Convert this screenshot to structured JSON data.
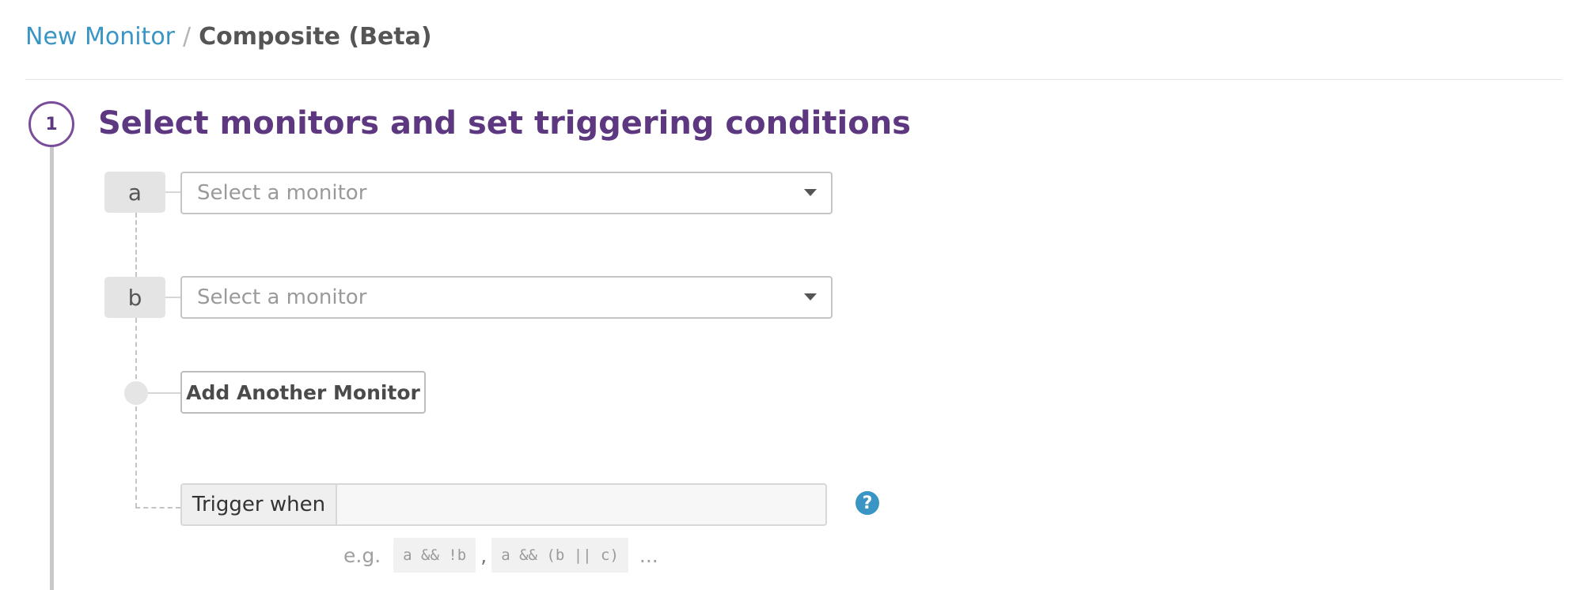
{
  "breadcrumb": {
    "link": "New Monitor",
    "separator": "/",
    "current": "Composite (Beta)"
  },
  "step": {
    "number": "1",
    "title": "Select monitors and set triggering conditions"
  },
  "monitors": [
    {
      "label": "a",
      "placeholder": "Select a monitor"
    },
    {
      "label": "b",
      "placeholder": "Select a monitor"
    }
  ],
  "add_button": {
    "label": "Add Another Monitor"
  },
  "trigger": {
    "label": "Trigger when",
    "value": "",
    "help_icon": "question-circle-icon",
    "help_glyph": "?"
  },
  "examples": {
    "prefix": "e.g.",
    "items": [
      "a && !b",
      "a && (b || c)"
    ],
    "separator": ",",
    "ellipsis": "..."
  },
  "colors": {
    "link": "#3a95c4",
    "accent": "#5d3880",
    "step_circle_border": "#7a4d9b"
  }
}
